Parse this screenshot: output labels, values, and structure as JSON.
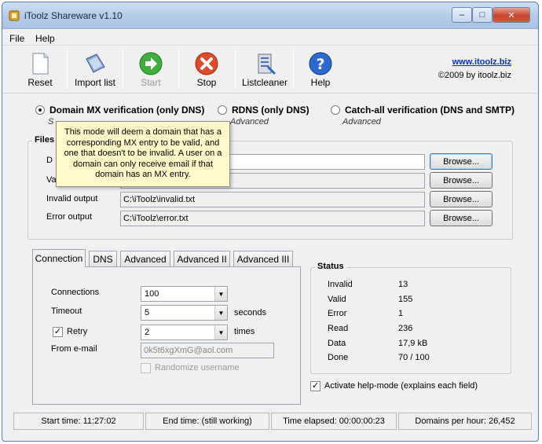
{
  "window": {
    "title": "iToolz Shareware v1.10"
  },
  "menu": {
    "items": [
      "File",
      "Help"
    ]
  },
  "toolbar": {
    "buttons": [
      {
        "label": "Reset",
        "icon": "document-icon"
      },
      {
        "label": "Import list",
        "icon": "import-icon"
      },
      {
        "label": "Start",
        "icon": "green-arrow-icon",
        "disabled": true
      },
      {
        "label": "Stop",
        "icon": "red-x-icon"
      },
      {
        "label": "Listcleaner",
        "icon": "listcleaner-icon"
      },
      {
        "label": "Help",
        "icon": "help-icon"
      }
    ],
    "website": "www.itoolz.biz",
    "copyright": "©2009 by itoolz.biz"
  },
  "modes": {
    "mx": {
      "label": "Domain MX verification (only DNS)",
      "sub": "S",
      "selected": true
    },
    "rdns": {
      "label": "RDNS (only DNS)",
      "sub": "Advanced",
      "selected": false
    },
    "catchall": {
      "label": "Catch-all verification (DNS and SMTP)",
      "sub": "Advanced",
      "selected": false
    }
  },
  "tooltip": {
    "text": "This mode will deem a domain that has a corresponding MX entry to be valid, and one that doesn't to be invalid. A user on a domain can only receive email if that domain has an MX entry."
  },
  "files": {
    "group_label": "Files",
    "row1_label": "D",
    "row1_value": "",
    "row2_label": "Va",
    "row2_value": "",
    "invalid_label": "Invalid output",
    "invalid_value": "C:\\iToolz\\invalid.txt",
    "error_label": "Error output",
    "error_value": "C:\\iToolz\\error.txt",
    "browse_label": "Browse..."
  },
  "tabs": [
    "Connection",
    "DNS",
    "Advanced",
    "Advanced II",
    "Advanced III"
  ],
  "connection": {
    "connections_label": "Connections",
    "connections_value": "100",
    "timeout_label": "Timeout",
    "timeout_value": "5",
    "timeout_unit": "seconds",
    "retry_label": "Retry",
    "retry_checked": true,
    "retry_value": "2",
    "retry_unit": "times",
    "from_label": "From e-mail",
    "from_value": "0k5t6xgXmG@aol.com",
    "randomize_label": "Randomize username"
  },
  "status": {
    "label": "Status",
    "rows": [
      {
        "name": "Invalid",
        "value": "13"
      },
      {
        "name": "Valid",
        "value": "155"
      },
      {
        "name": "Error",
        "value": "1"
      },
      {
        "name": "Read",
        "value": "236"
      },
      {
        "name": "Data",
        "value": "17,9 kB"
      },
      {
        "name": "Done",
        "value": "70 / 100"
      }
    ]
  },
  "helpmode": {
    "label": "Activate help-mode (explains each field)",
    "checked": true
  },
  "statusbar": {
    "start": "Start time: 11:27:02",
    "end": "End time: (still working)",
    "elapsed": "Time elapsed: 00:00:00:23",
    "dph": "Domains per hour: 26,452"
  },
  "colors": {
    "link": "#0033cc",
    "tooltip_bg": "#fff8c8",
    "close": "#c8452d"
  }
}
